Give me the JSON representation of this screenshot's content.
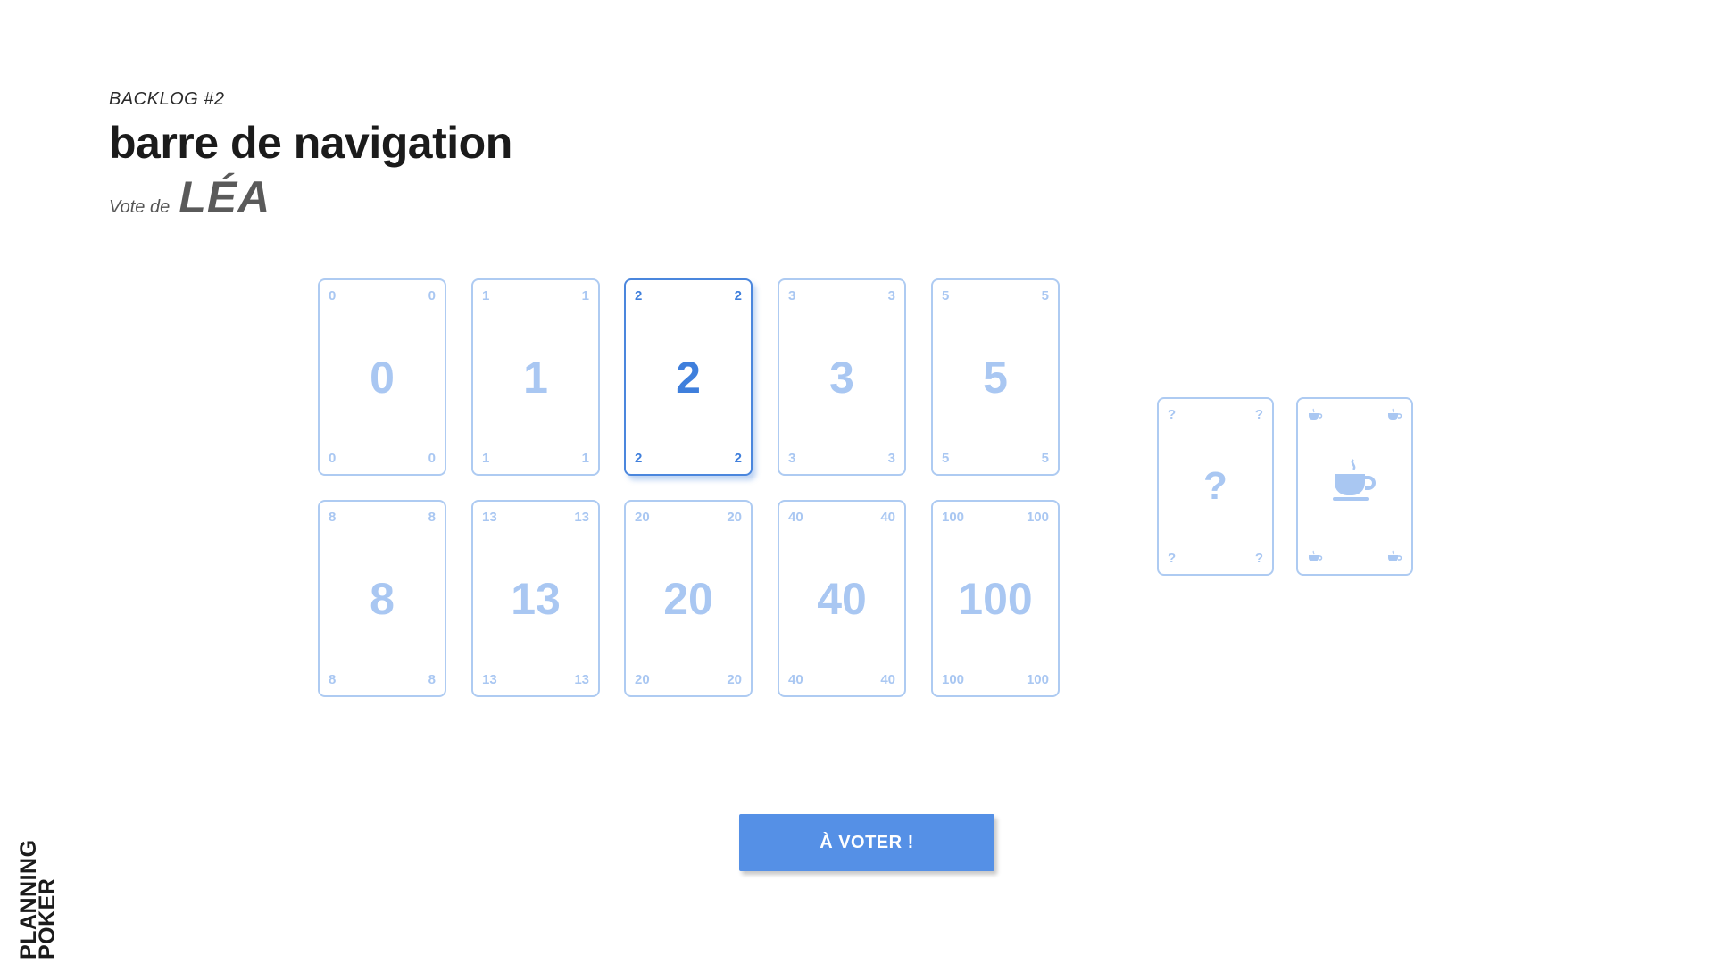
{
  "header": {
    "backlog_label": "BACKLOG #2",
    "title": "barre de navigation",
    "vote_prefix": "Vote de",
    "voter_name": "LÉA"
  },
  "cards": {
    "row1": [
      "0",
      "1",
      "2",
      "3",
      "5"
    ],
    "row2": [
      "8",
      "13",
      "20",
      "40",
      "100"
    ],
    "unknown": "?",
    "coffee_icon": "coffee-cup-icon",
    "selected_value": "2"
  },
  "action": {
    "vote_button_label": "À VOTER !"
  },
  "brand": {
    "line1": "PLANNING",
    "line2": "POKER"
  },
  "colors": {
    "card_inactive": "#a9c7f2",
    "card_selected": "#3f7fdc",
    "button_bg": "#5590e6"
  }
}
